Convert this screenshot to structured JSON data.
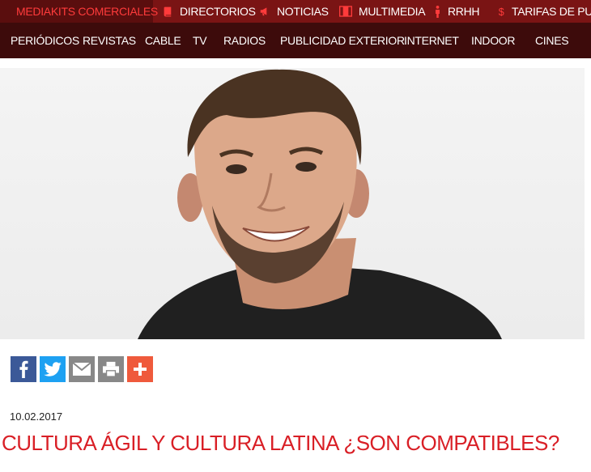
{
  "colors": {
    "topnav_bg": "#7a1414",
    "secnav_bg": "#3d0b0b",
    "active_text": "#ff3b3b",
    "title_red": "#d91f26"
  },
  "topnav": {
    "items": [
      {
        "label": "MEDIAKITS COMERCIALES",
        "icon": "star-icon"
      },
      {
        "label": "DIRECTORIOS",
        "icon": "book-icon"
      },
      {
        "label": "NOTICIAS",
        "icon": "megaphone-icon"
      },
      {
        "label": "MULTIMEDIA",
        "icon": "film-icon"
      },
      {
        "label": "RRHH",
        "icon": "person-icon"
      },
      {
        "label": "TARIFAS DE PUBLI",
        "icon": "dollar-icon"
      }
    ]
  },
  "secnav": {
    "items": [
      "PERIÓDICOS",
      "REVISTAS",
      "CABLE",
      "TV",
      "RADIOS",
      "PUBLICIDAD EXTERIOR",
      "INTERNET",
      "INDOOR",
      "CINES"
    ]
  },
  "article": {
    "date": "10.02.2017",
    "title": "CULTURA ÁGIL Y CULTURA LATINA ¿SON COMPATIBLES?"
  },
  "share_icons": [
    "facebook-icon",
    "twitter-icon",
    "email-icon",
    "print-icon",
    "plus-icon"
  ]
}
